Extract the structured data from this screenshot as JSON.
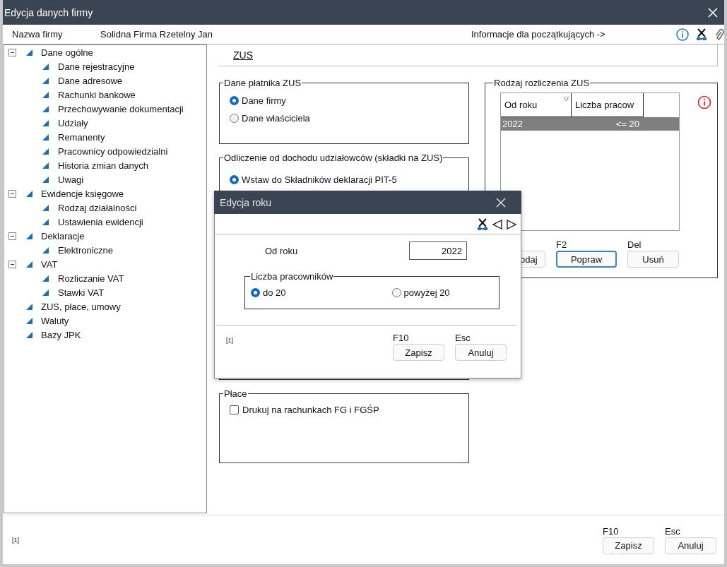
{
  "window": {
    "title": "Edycja danych firmy"
  },
  "header": {
    "label": "Nazwa firmy",
    "value": "Solidna Firma Rzetelny Jan",
    "help_link": "Informacje dla początkujących ->"
  },
  "tree": [
    {
      "label": "Dane ogólne",
      "expanded": true,
      "children": [
        {
          "label": "Dane rejestracyjne"
        },
        {
          "label": "Dane adresowe"
        },
        {
          "label": "Rachunki bankowe"
        },
        {
          "label": "Przechowywanie dokumentacji"
        },
        {
          "label": "Udziały"
        },
        {
          "label": "Remanenty"
        },
        {
          "label": "Pracownicy odpowiedzialni"
        },
        {
          "label": "Historia zmian danych"
        },
        {
          "label": "Uwagi"
        }
      ]
    },
    {
      "label": "Ewidencje księgowe",
      "expanded": true,
      "children": [
        {
          "label": "Rodzaj działalności"
        },
        {
          "label": "Ustawienia ewidencji"
        }
      ]
    },
    {
      "label": "Deklaracje",
      "expanded": true,
      "children": [
        {
          "label": "Elektroniczne"
        }
      ]
    },
    {
      "label": "VAT",
      "expanded": true,
      "children": [
        {
          "label": "Rozliczanie VAT"
        },
        {
          "label": "Stawki VAT"
        }
      ]
    },
    {
      "label": "ZUS, płace, umowy"
    },
    {
      "label": "Waluty"
    },
    {
      "label": "Bazy JPK"
    }
  ],
  "section_title": "ZUS",
  "payer_group": {
    "title": "Dane płatnika ZUS",
    "options": [
      {
        "label": "Dane firmy",
        "selected": true
      },
      {
        "label": "Dane właściciela",
        "selected": false
      }
    ]
  },
  "deduction_group": {
    "title": "Odliczenie od dochodu udziałowców (składki na ZUS)",
    "options": [
      {
        "label": "Wstaw do Składników deklaracji PIT-5",
        "selected": true
      }
    ]
  },
  "settlement_group": {
    "title": "Rodzaj rozliczenia ZUS",
    "table": {
      "columns": [
        "Od roku",
        "Liczba pracow"
      ],
      "rows": [
        {
          "cells": [
            "2022",
            "<= 20"
          ],
          "selected": true
        }
      ]
    },
    "actions": [
      {
        "label": "odaj",
        "focused": false
      },
      {
        "shortcut": "F2",
        "label": "Popraw",
        "focused": true
      },
      {
        "shortcut": "Del",
        "label": "Usuń",
        "focused": false
      }
    ]
  },
  "wages_group": {
    "title": "Płace",
    "checkboxes": [
      {
        "label": "Drukuj na rachunkach FG i FGŚP",
        "checked": false
      }
    ]
  },
  "footer": {
    "note": "[1]",
    "buttons": [
      {
        "shortcut": "F10",
        "label": "Zapisz"
      },
      {
        "shortcut": "Esc",
        "label": "Anuluj"
      }
    ]
  },
  "dialog": {
    "title": "Edycja roku",
    "field": {
      "label": "Od roku",
      "value": "2022"
    },
    "group": {
      "title": "Liczba pracowników",
      "options": [
        {
          "label": "do 20",
          "selected": true
        },
        {
          "label": "powyżej 20",
          "selected": false
        }
      ]
    },
    "note": "[1]",
    "buttons": [
      {
        "shortcut": "F10",
        "label": "Zapisz"
      },
      {
        "shortcut": "Esc",
        "label": "Anuluj"
      }
    ]
  }
}
